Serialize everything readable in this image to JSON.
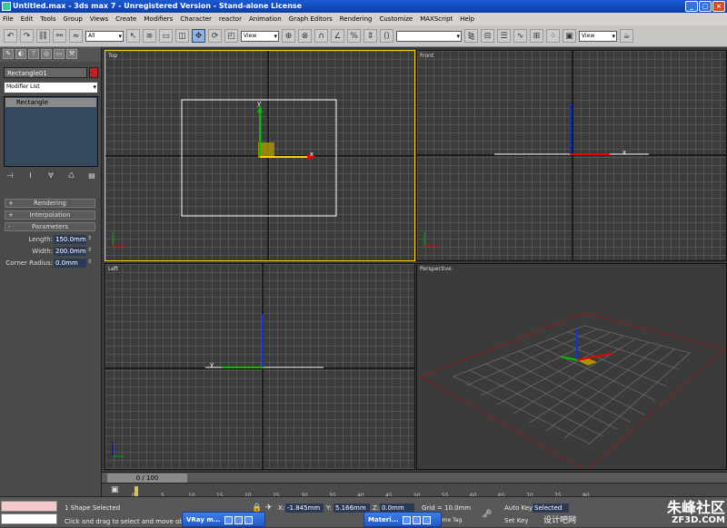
{
  "window": {
    "title": "Untitled.max - 3ds max 7 - Unregistered Version - Stand-alone License"
  },
  "menu": [
    "File",
    "Edit",
    "Tools",
    "Group",
    "Views",
    "Create",
    "Modifiers",
    "Character",
    "reactor",
    "Animation",
    "Graph Editors",
    "Rendering",
    "Customize",
    "MAXScript",
    "Help"
  ],
  "toolbar": {
    "selection_filter": "All",
    "ref_coord": "View",
    "ref_coord2": "View"
  },
  "command_panel": {
    "object_name": "Rectangle01",
    "object_color": "#c02020",
    "modifier_list": "Modifier List",
    "stack_item": "Rectangle",
    "rollouts": [
      {
        "sign": "+",
        "label": "Rendering"
      },
      {
        "sign": "+",
        "label": "Interpolation"
      },
      {
        "sign": "-",
        "label": "Parameters"
      }
    ],
    "params": [
      {
        "label": "Length:",
        "value": "150.0mm"
      },
      {
        "label": "Width:",
        "value": "200.0mm"
      },
      {
        "label": "Corner Radius:",
        "value": "0.0mm"
      }
    ]
  },
  "viewports": {
    "top": "Top",
    "front": "Front",
    "left": "Left",
    "perspective": "Perspective"
  },
  "axes": {
    "x": "x",
    "y": "y",
    "z": "z"
  },
  "timeline": {
    "slider": "0 / 100",
    "ticks": [
      "0",
      "5",
      "10",
      "15",
      "20",
      "25",
      "30",
      "35",
      "40",
      "45",
      "50",
      "55",
      "60",
      "65",
      "70",
      "75",
      "80"
    ]
  },
  "status": {
    "selected": "1 Shape Selected",
    "prompt": "Click and drag to select and move objects",
    "x_label": "X:",
    "x_value": "-1.845mm",
    "y_label": "Y:",
    "y_value": "5.166mm",
    "z_label": "Z:",
    "z_value": "0.0mm",
    "grid": "Grid = 10.0mm",
    "auto_key": "Auto Key",
    "selected_key": "Selected",
    "set_key": "Set Key",
    "add_time_tag": "Add Time Tag"
  },
  "taskbar": [
    {
      "label": "VRay m..."
    },
    {
      "label": "Materi..."
    }
  ],
  "watermark": {
    "brand": "朱峰社区",
    "url": "ZF3D.COM",
    "slogan": "设计吧网"
  }
}
